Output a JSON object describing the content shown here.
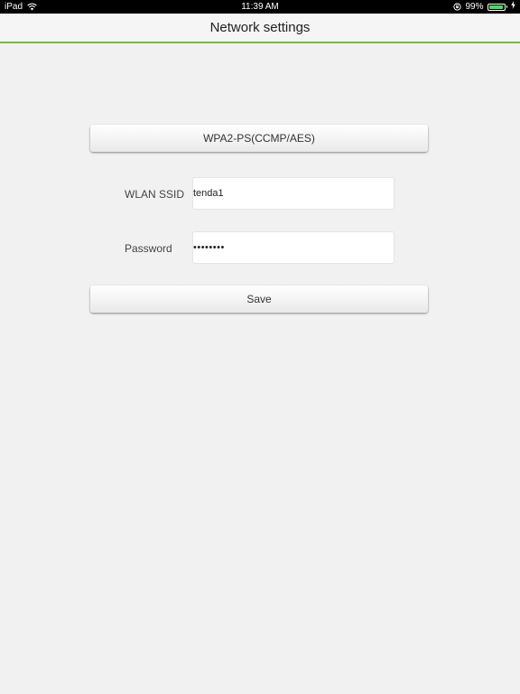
{
  "status_bar": {
    "device": "iPad",
    "time": "11:39 AM",
    "battery_percent": "99%",
    "battery_level": 0.99,
    "battery_color": "#4cd964"
  },
  "header": {
    "title": "Network settings",
    "accent_color": "#77bb41"
  },
  "form": {
    "security_mode_label": "WPA2-PS(CCMP/AES)",
    "ssid": {
      "label": "WLAN SSID",
      "value": "tenda1"
    },
    "password": {
      "label": "Password",
      "masked_value": "••••••••"
    },
    "save_label": "Save"
  },
  "icons": {
    "wifi": "wifi-icon",
    "rotation_lock": "rotation-lock-icon",
    "battery": "battery-icon",
    "charging": "charging-bolt-icon"
  }
}
